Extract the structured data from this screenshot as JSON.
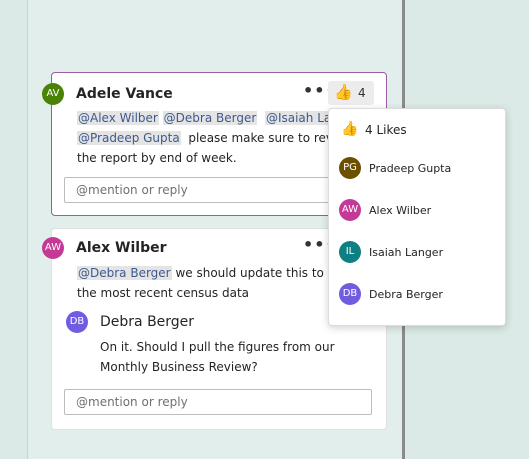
{
  "colors": {
    "adele": "#498205",
    "alex": "#c43996",
    "debra": "#6f5ce0",
    "pradeep": "#6b5000",
    "isaiah": "#0e7f83"
  },
  "comments": [
    {
      "author": "Adele Vance",
      "initials": "AV",
      "mentions": [
        "@Alex Wilber",
        "@Debra Berger",
        "@Isaiah Langer",
        "@Pradeep Gupta"
      ],
      "text_tail": "please make sure to review",
      "text_line3": "the report by end of week.",
      "more_icon": "more-icon",
      "likes": "4",
      "reply_placeholder": "@mention or reply"
    },
    {
      "author": "Alex Wilber",
      "initials": "AW",
      "mention": "@Debra Berger",
      "text_tail": "we should update this to reflect",
      "text_line2": "the most recent census data",
      "reply": {
        "author": "Debra Berger",
        "initials": "DB",
        "line1": "On it. Should I pull the figures from our",
        "line2": "Monthly Business Review?"
      },
      "reply_placeholder": "@mention or reply"
    }
  ],
  "likes_popup": {
    "header": "4 Likes",
    "people": [
      {
        "initials": "PG",
        "name": "Pradeep Gupta"
      },
      {
        "initials": "AW",
        "name": "Alex Wilber"
      },
      {
        "initials": "IL",
        "name": "Isaiah Langer"
      },
      {
        "initials": "DB",
        "name": "Debra Berger"
      }
    ]
  }
}
